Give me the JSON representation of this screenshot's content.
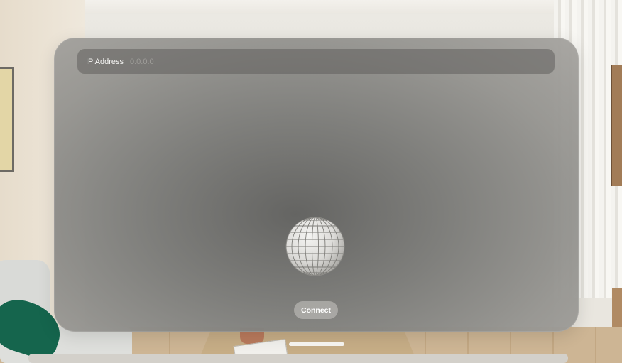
{
  "window": {
    "ip_field": {
      "label": "IP Address",
      "value": "",
      "placeholder": "0.0.0.0"
    },
    "globe": {
      "icon": "wireframe-globe-icon"
    },
    "connect_button": {
      "label": "Connect"
    }
  },
  "colors": {
    "window_glass": "#8a8986",
    "button": "#c8c7c3",
    "text": "#ffffff"
  }
}
